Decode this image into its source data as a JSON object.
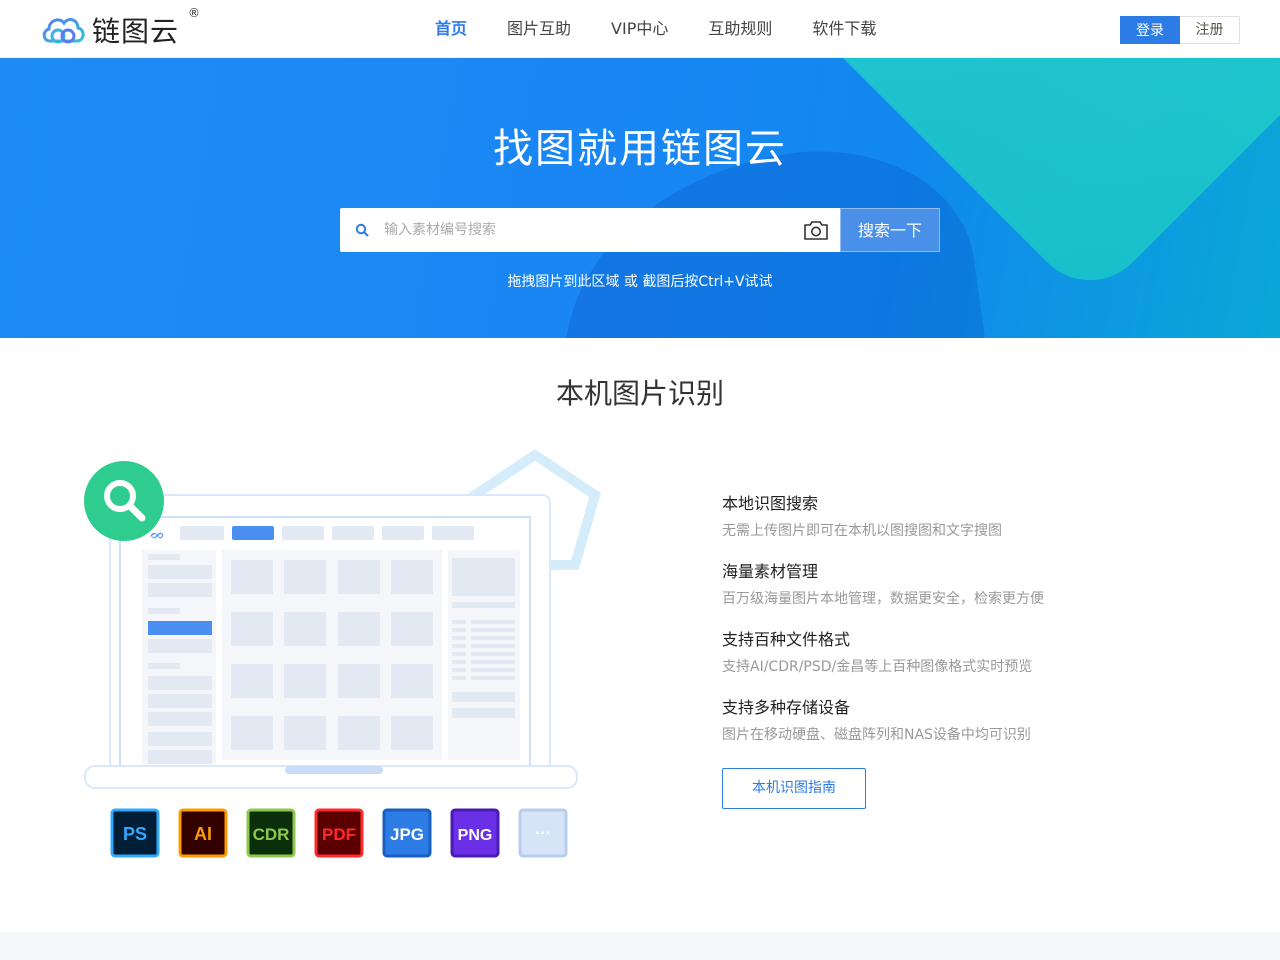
{
  "header": {
    "logo_text": "链图云",
    "logo_reg": "®",
    "nav": [
      {
        "label": "首页",
        "active": true
      },
      {
        "label": "图片互助",
        "active": false
      },
      {
        "label": "VIP中心",
        "active": false
      },
      {
        "label": "互助规则",
        "active": false
      },
      {
        "label": "软件下载",
        "active": false
      }
    ],
    "login_label": "登录",
    "register_label": "注册"
  },
  "hero": {
    "title": "找图就用链图云",
    "search_placeholder": "输入素材编号搜索",
    "search_button": "搜索一下",
    "hint": "拖拽图片到此区域 或 截图后按Ctrl+V试试"
  },
  "section": {
    "title": "本机图片识别",
    "features": [
      {
        "title": "本地识图搜索",
        "desc": "无需上传图片即可在本机以图搜图和文字搜图"
      },
      {
        "title": "海量素材管理",
        "desc": "百万级海量图片本地管理，数据更安全，检索更方便"
      },
      {
        "title": "支持百种文件格式",
        "desc": "支持AI/CDR/PSD/金昌等上百种图像格式实时预览"
      },
      {
        "title": "支持多种存储设备",
        "desc": "图片在移动硬盘、磁盘阵列和NAS设备中均可识别"
      }
    ],
    "guide_button": "本机识图指南",
    "formats": [
      {
        "label": "PS",
        "bg": "#001e36",
        "fg": "#31a8ff"
      },
      {
        "label": "AI",
        "bg": "#330000",
        "fg": "#ff9a00"
      },
      {
        "label": "CDR",
        "bg": "#0b2e0b",
        "fg": "#8cc84b"
      },
      {
        "label": "PDF",
        "bg": "#5a0000",
        "fg": "#ff2a2a"
      },
      {
        "label": "JPG",
        "bg": "#2d7be5",
        "fg": "#ffffff"
      },
      {
        "label": "PNG",
        "bg": "#6a2fe6",
        "fg": "#ffffff"
      },
      {
        "label": "···",
        "bg": "#d6e4f8",
        "fg": "#ffffff"
      }
    ]
  },
  "colors": {
    "accent": "#2d7be5",
    "hero_start": "#1f8cf5",
    "hero_end": "#0aa7d6",
    "search_green": "#2ecc8f"
  }
}
